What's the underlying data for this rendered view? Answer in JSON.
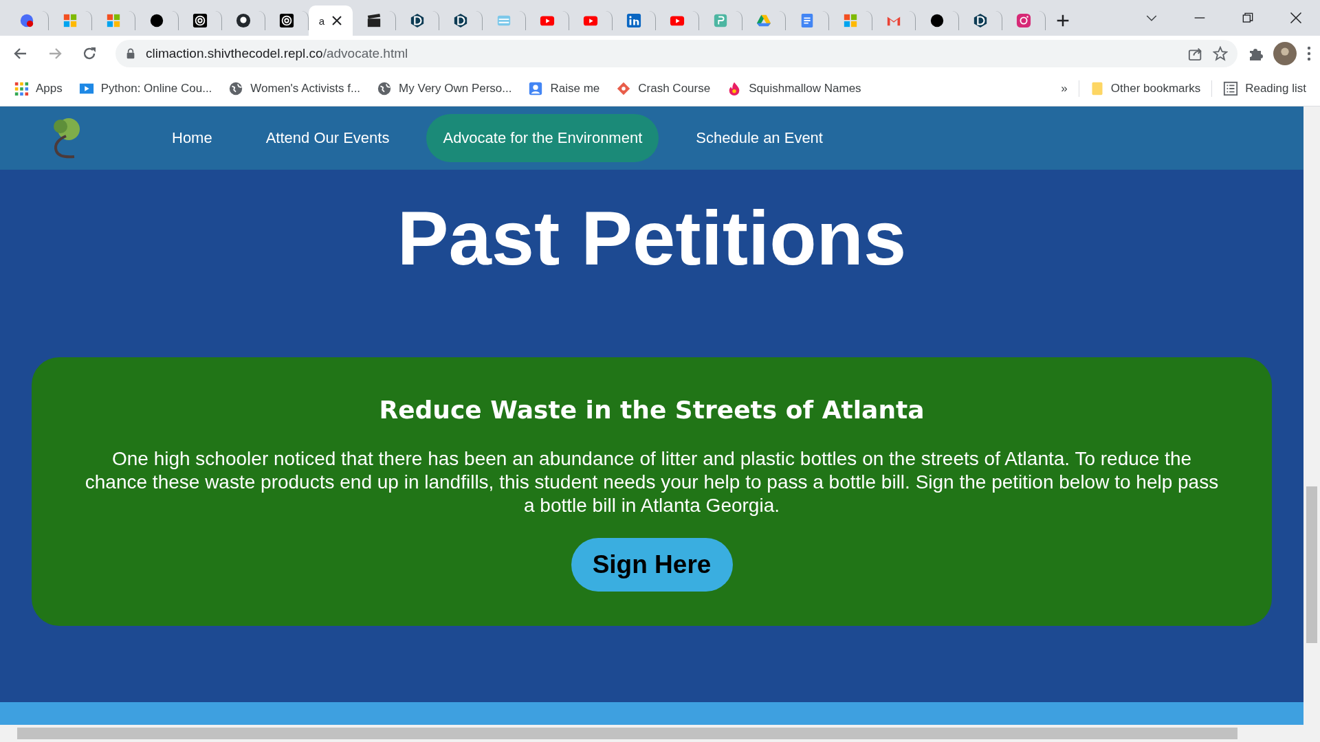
{
  "browser": {
    "tabs": [
      {
        "selected": false
      },
      {
        "selected": false
      },
      {
        "selected": false
      },
      {
        "selected": false
      },
      {
        "selected": false
      },
      {
        "selected": false
      },
      {
        "selected": false
      },
      {
        "selected": true,
        "title": "a"
      },
      {
        "selected": false
      },
      {
        "selected": false
      },
      {
        "selected": false
      },
      {
        "selected": false
      },
      {
        "selected": false
      },
      {
        "selected": false
      },
      {
        "selected": false
      },
      {
        "selected": false
      },
      {
        "selected": false
      },
      {
        "selected": false
      },
      {
        "selected": false
      },
      {
        "selected": false
      },
      {
        "selected": false
      },
      {
        "selected": false
      },
      {
        "selected": false
      },
      {
        "selected": false
      }
    ],
    "address": {
      "host": "climaction.shivthecodel.repl.co",
      "path": "/advocate.html"
    },
    "bookmarks": [
      "Apps",
      "Python: Online Cou...",
      "Women's Activists f...",
      "My Very Own Perso...",
      "Raise me",
      "Crash Course",
      "Squishmallow Names"
    ],
    "more": "»",
    "other_bookmarks": "Other bookmarks",
    "reading_list": "Reading list"
  },
  "nav": {
    "items": [
      {
        "label": "Home",
        "selected": false
      },
      {
        "label": "Attend Our Events",
        "selected": false
      },
      {
        "label": "Advocate for the Environment",
        "selected": true
      },
      {
        "label": "Schedule an Event",
        "selected": false
      }
    ]
  },
  "heading": "Past Petitions",
  "petitions": [
    {
      "title": "Reduce Waste in the Streets of Atlanta",
      "description": "One high schooler noticed that there has been an abundance of litter and plastic bottles on the streets of Atlanta. To reduce the chance these waste products end up in landfills, this student needs your help to pass a bottle bill. Sign the petition below to help pass a bottle bill in Atlanta Georgia.",
      "button": "Sign Here"
    }
  ]
}
